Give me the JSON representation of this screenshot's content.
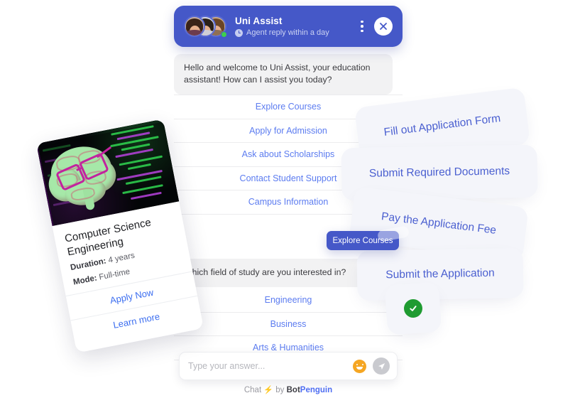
{
  "header": {
    "bot_name": "Uni Assist",
    "status_text": "Agent reply within a day",
    "clock_icon": "clock-icon",
    "menu_icon": "kebab-menu-icon",
    "close_icon": "close-icon",
    "accent_color": "#4558c8",
    "online_color": "#3ecf4c"
  },
  "conversation": {
    "welcome_message": "Hello and welcome to Uni Assist, your education assistant! How can I assist you today?",
    "options": [
      {
        "label": "Explore Courses"
      },
      {
        "label": "Apply for Admission"
      },
      {
        "label": "Ask about Scholarships"
      },
      {
        "label": "Contact Student Support"
      },
      {
        "label": "Campus Information"
      }
    ],
    "question_message": "Which field of study are you interested in?",
    "field_options": [
      {
        "label": "Engineering"
      },
      {
        "label": "Business"
      },
      {
        "label": "Arts & Humanities"
      }
    ],
    "sent_reply": "Explore Courses"
  },
  "composer": {
    "placeholder": "Type your answer...",
    "value": "",
    "emoji_icon": "smiley-icon",
    "send_icon": "send-paper-plane-icon"
  },
  "footer": {
    "prefix": "Chat",
    "bolt": "⚡",
    "by": "by",
    "brand_bot": "Bot",
    "brand_penguin": "Penguin",
    "brand_color": "#4f6ef2"
  },
  "course_card": {
    "title": "Computer Science Engineering",
    "duration_label": "Duration:",
    "duration_value": "4 years",
    "mode_label": "Mode:",
    "mode_value": "Full-time",
    "apply_link": "Apply Now",
    "learn_link": "Learn more",
    "image_alt": "brain-with-glasses-code-background"
  },
  "steps": [
    {
      "label": "Fill out Application Form"
    },
    {
      "label": "Submit Required Documents"
    },
    {
      "label": "Pay the Application Fee"
    },
    {
      "label": "Submit the Application"
    }
  ],
  "status": {
    "check_icon": "check-circle-icon",
    "check_color": "#1f9b31"
  }
}
